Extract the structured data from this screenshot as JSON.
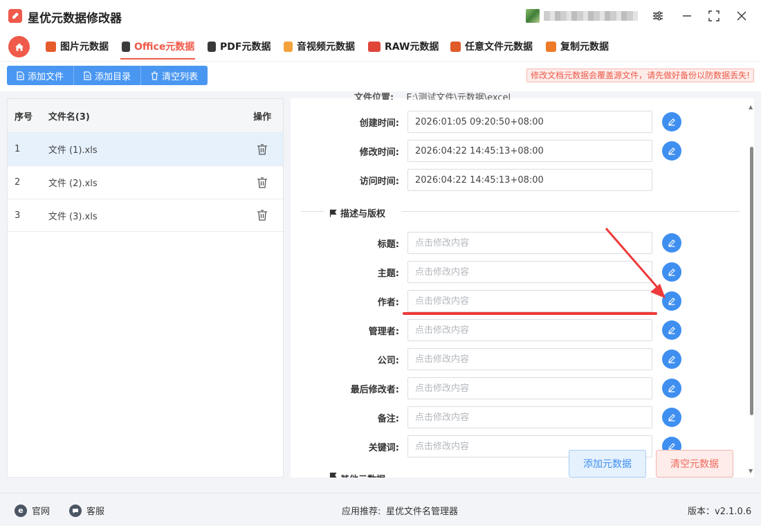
{
  "app": {
    "title": "星优元数据修改器",
    "colors": {
      "accent": "#ef5a4a",
      "primary": "#4a97f2",
      "edit": "#3f8ff0"
    }
  },
  "nav": {
    "active_index": 1,
    "items": [
      {
        "label": "图片元数据",
        "icon": "image-icon"
      },
      {
        "label": "Office元数据",
        "icon": "office-icon"
      },
      {
        "label": "PDF元数据",
        "icon": "pdf-icon"
      },
      {
        "label": "音视频元数据",
        "icon": "media-icon"
      },
      {
        "label": "RAW元数据",
        "icon": "raw-icon"
      },
      {
        "label": "任意文件元数据",
        "icon": "any-file-icon"
      },
      {
        "label": "复制元数据",
        "icon": "copy-icon"
      }
    ]
  },
  "toolbar": {
    "add_file": "添加文件",
    "add_folder": "添加目录",
    "clear_list": "清空列表",
    "warning": "修改文档元数据会覆盖源文件，请先做好备份以防数据丢失!"
  },
  "file_table": {
    "headers": {
      "no": "序号",
      "name": "文件名(3)",
      "op": "操作"
    },
    "rows": [
      {
        "no": "1",
        "name": "文件 (1).xls"
      },
      {
        "no": "2",
        "name": "文件 (2).xls"
      },
      {
        "no": "3",
        "name": "文件 (3).xls"
      }
    ]
  },
  "meta": {
    "cut_label": "文件位置:",
    "cut_value": "E:\\测试文件\\元数据\\excel",
    "time_fields": [
      {
        "label": "创建时间:",
        "value": "2026:01:05 09:20:50+08:00"
      },
      {
        "label": "修改时间:",
        "value": "2026:04:22 14:45:13+08:00"
      },
      {
        "label": "访问时间:",
        "value": "2026:04:22 14:45:13+08:00"
      }
    ],
    "section_title": "描述与版权",
    "placeholder": "点击修改内容",
    "desc_fields": [
      {
        "label": "标题:"
      },
      {
        "label": "主题:"
      },
      {
        "label": "作者:"
      },
      {
        "label": "管理者:"
      },
      {
        "label": "公司:"
      },
      {
        "label": "最后修改者:"
      },
      {
        "label": "备注:"
      },
      {
        "label": "关键词:"
      }
    ],
    "next_section": "其他元数据"
  },
  "actions": {
    "add_meta": "添加元数据",
    "clear_meta": "清空元数据"
  },
  "footer": {
    "website": "官网",
    "support": "客服",
    "recommend_label": "应用推荐:",
    "recommend_app": "星优文件名管理器",
    "version": "版本：v2.1.0.6"
  }
}
